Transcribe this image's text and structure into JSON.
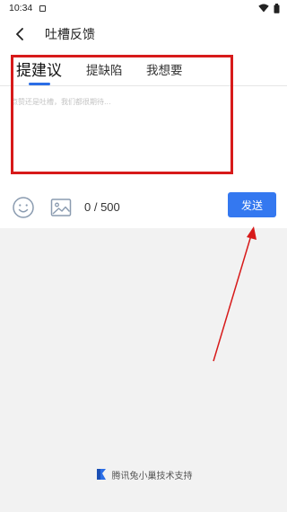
{
  "status_bar": {
    "time": "10:34",
    "icons": [
      "notification-icon",
      "wifi-icon",
      "battery-icon"
    ]
  },
  "header": {
    "title": "吐槽反馈",
    "back_icon": "back-arrow-icon"
  },
  "tabs": [
    {
      "label": "提建议",
      "active": true
    },
    {
      "label": "提缺陷",
      "active": false
    },
    {
      "label": "我想要",
      "active": false
    }
  ],
  "feedback": {
    "value": "",
    "placeholder": "点赞还是吐槽，我们都很期待..."
  },
  "toolbar": {
    "emoji_icon": "emoji-icon",
    "image_icon": "image-icon",
    "char_count": "0 / 500",
    "send_label": "发送"
  },
  "footer": {
    "logo_icon": "tencent-rabbit-logo-icon",
    "text": "腾讯兔小巢技术支持"
  },
  "colors": {
    "accent": "#3478f0",
    "annotation_red": "#d71a1a",
    "background": "#f2f2f2"
  }
}
